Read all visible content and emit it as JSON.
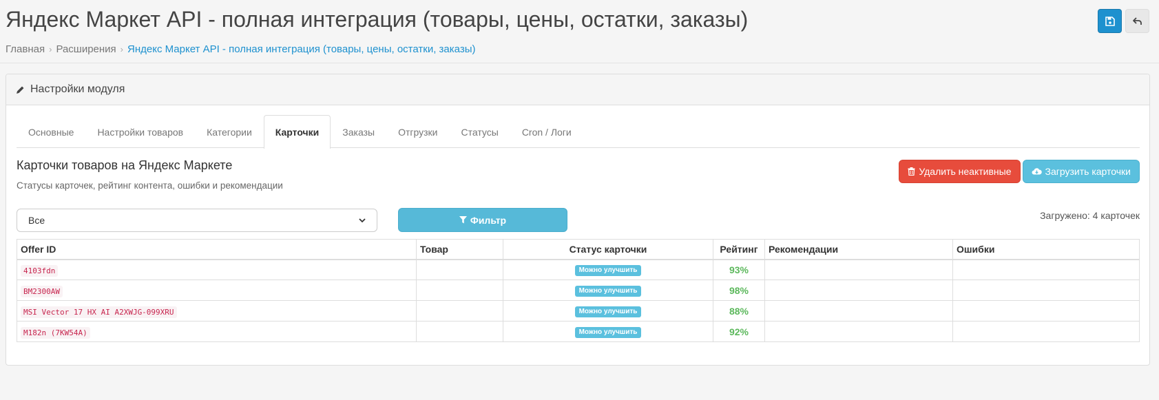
{
  "header": {
    "title": "Яндекс Маркет API - полная интеграция (товары, цены, остатки, заказы)",
    "breadcrumb": [
      "Главная",
      "Расширения",
      "Яндекс Маркет API - полная интеграция (товары, цены, остатки, заказы)"
    ],
    "save_icon": "save-icon",
    "back_icon": "reply-icon"
  },
  "panel": {
    "heading": "Настройки модуля",
    "heading_icon": "pencil-icon",
    "tabs": [
      "Основные",
      "Настройки товаров",
      "Категории",
      "Карточки",
      "Заказы",
      "Отгрузки",
      "Статусы",
      "Cron / Логи"
    ],
    "active_tab": "Карточки"
  },
  "section": {
    "title": "Карточки товаров на Яндекс Маркете",
    "subtitle": "Статусы карточек, рейтинг контента, ошибки и рекомендации",
    "delete_button": "Удалить неактивные",
    "load_button": "Загрузить карточки"
  },
  "filter": {
    "selected": "Все",
    "button": "Фильтр",
    "loaded_text": "Загружено: 4 карточек"
  },
  "table": {
    "columns": [
      "Offer ID",
      "Товар",
      "Статус карточки",
      "Рейтинг",
      "Рекомендации",
      "Ошибки"
    ],
    "rows": [
      {
        "offer_id": "4103fdn",
        "product": "",
        "status": "Можно улучшить",
        "rating": "93%",
        "recommendations": "",
        "errors": ""
      },
      {
        "offer_id": "BM2300AW",
        "product": "",
        "status": "Можно улучшить",
        "rating": "98%",
        "recommendations": "",
        "errors": ""
      },
      {
        "offer_id": "MSI Vector 17 HX AI A2XWJG-099XRU",
        "product": "",
        "status": "Можно улучшить",
        "rating": "88%",
        "recommendations": "",
        "errors": ""
      },
      {
        "offer_id": "M182n (7KW54A)",
        "product": "",
        "status": "Можно улучшить",
        "rating": "92%",
        "recommendations": "",
        "errors": ""
      }
    ]
  },
  "colors": {
    "primary": "#1e91cf",
    "danger": "#e74c3c",
    "info": "#5bc0de",
    "success": "#5cb85c"
  }
}
